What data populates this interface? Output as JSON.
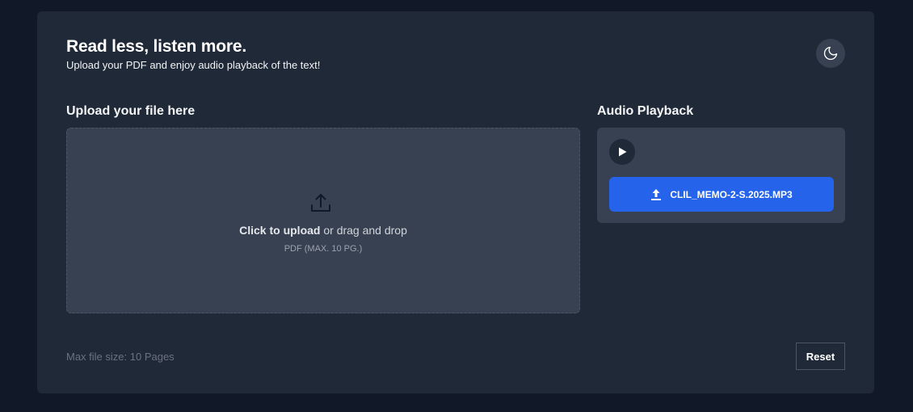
{
  "header": {
    "title": "Read less, listen more.",
    "subtitle": "Upload your PDF and enjoy audio playback of the text!",
    "theme_toggle_icon": "moon-icon"
  },
  "upload": {
    "section_title": "Upload your file here",
    "click_label": "Click to upload",
    "drag_label": " or drag and drop",
    "hint": "PDF (MAX. 10 PG.)",
    "icon": "upload-icon"
  },
  "audio": {
    "section_title": "Audio Playback",
    "play_icon": "play-icon",
    "download_icon": "download-icon",
    "file_name": "CLIL_MEMO-2-S.2025.MP3"
  },
  "footer": {
    "note": "Max file size: 10 Pages",
    "reset_label": "Reset"
  },
  "colors": {
    "background": "#111827",
    "card": "#1f2937",
    "panel": "#374151",
    "accent": "#2563eb"
  }
}
